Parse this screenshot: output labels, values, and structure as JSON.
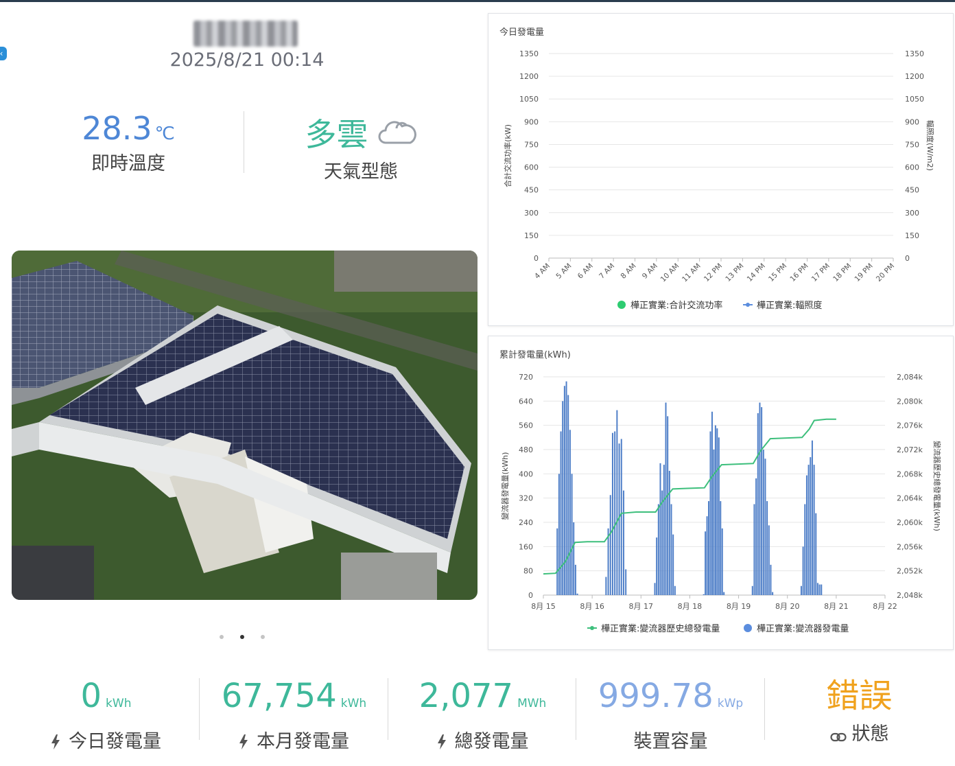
{
  "header": {
    "datetime": "2025/8/21 00:14"
  },
  "weather": {
    "temperature": "28.3",
    "temperature_unit": "℃",
    "temperature_label": "即時溫度",
    "type": "多雲",
    "type_label": "天氣型態",
    "icon": "cloud-icon"
  },
  "carousel": {
    "slide_count": 3,
    "active_index": 1
  },
  "today_chart": {
    "title": "今日發電量",
    "chart_data": {
      "type": "line",
      "ylabel": "合計交流功率(kW)",
      "ylabel_right": "輻照度(W/m2)",
      "y_ticks": [
        "0",
        "150",
        "300",
        "450",
        "600",
        "750",
        "900",
        "1050",
        "1200",
        "1350"
      ],
      "y_ticks_right": [
        "0",
        "150",
        "300",
        "450",
        "600",
        "750",
        "900",
        "1050",
        "1200",
        "1350"
      ],
      "x_ticks": [
        "4 AM",
        "5 AM",
        "6 AM",
        "7 AM",
        "8 AM",
        "9 AM",
        "10 AM",
        "11 AM",
        "12 PM",
        "13 PM",
        "14 PM",
        "15 PM",
        "16 PM",
        "17 PM",
        "18 PM",
        "19 PM",
        "20 PM"
      ],
      "ylim": [
        0,
        1350
      ],
      "series": [
        {
          "name": "樺正實業:合計交流功率",
          "color": "#2ecc71",
          "values": []
        },
        {
          "name": "樺正實業:輻照度",
          "color": "#5b8dde",
          "values": []
        }
      ],
      "legend": "bottom"
    }
  },
  "cumulative_chart": {
    "title": "累計發電量(kWh)",
    "chart_data": {
      "type": "bar",
      "ylabel": "變流器發電量(kWh)",
      "ylabel_right": "變流器歷史總發電量(kWh)",
      "y_ticks": [
        "0",
        "80",
        "160",
        "240",
        "320",
        "400",
        "480",
        "560",
        "640",
        "720"
      ],
      "y_ticks_right": [
        "2,048k",
        "2,052k",
        "2,056k",
        "2,060k",
        "2,064k",
        "2,068k",
        "2,072k",
        "2,076k",
        "2,080k",
        "2,084k"
      ],
      "x_ticks": [
        "8月 15",
        "8月 16",
        "8月 17",
        "8月 18",
        "8月 19",
        "8月 20",
        "8月 21",
        "8月 22"
      ],
      "ylim": [
        0,
        720
      ],
      "ylim_right": [
        2048000,
        2084000
      ],
      "bar_series": {
        "name": "樺正實業:變流器發電量",
        "color": "#4f7fc8",
        "days": [
          [
            220,
            400,
            540,
            640,
            690,
            705,
            660,
            545,
            400,
            240,
            100,
            5
          ],
          [
            60,
            220,
            330,
            535,
            540,
            610,
            500,
            515,
            345,
            85
          ],
          [
            40,
            190,
            300,
            435,
            345,
            430,
            635,
            590,
            410,
            300,
            200,
            30
          ],
          [
            3,
            210,
            260,
            310,
            540,
            605,
            480,
            560,
            550,
            520,
            310,
            220,
            10
          ],
          [
            30,
            300,
            385,
            600,
            635,
            620,
            480,
            450,
            310,
            230,
            100,
            10
          ],
          [
            30,
            160,
            300,
            395,
            430,
            455,
            510,
            430,
            270,
            40,
            35,
            35
          ]
        ]
      },
      "line_series": {
        "name": "樺正實業:變流器歷史總發電量",
        "color": "#3dbf7c",
        "points": [
          [
            15.0,
            2051.5
          ],
          [
            15.25,
            2051.6
          ],
          [
            15.45,
            2053.5
          ],
          [
            15.65,
            2056.7
          ],
          [
            15.9,
            2056.8
          ],
          [
            16.25,
            2056.8
          ],
          [
            16.4,
            2058.5
          ],
          [
            16.6,
            2061.5
          ],
          [
            16.9,
            2061.7
          ],
          [
            17.3,
            2061.7
          ],
          [
            17.45,
            2063.5
          ],
          [
            17.65,
            2065.5
          ],
          [
            17.95,
            2065.6
          ],
          [
            18.3,
            2065.7
          ],
          [
            18.45,
            2067.5
          ],
          [
            18.65,
            2069.5
          ],
          [
            18.95,
            2069.6
          ],
          [
            19.3,
            2069.7
          ],
          [
            19.45,
            2071.8
          ],
          [
            19.65,
            2073.8
          ],
          [
            19.95,
            2073.9
          ],
          [
            20.3,
            2074.0
          ],
          [
            20.45,
            2075.4
          ],
          [
            20.55,
            2076.8
          ],
          [
            20.8,
            2077.0
          ],
          [
            21.0,
            2077.0
          ]
        ]
      },
      "legend": "bottom"
    }
  },
  "stats": [
    {
      "value": "0",
      "unit": "kWh",
      "label": "今日發電量",
      "color": "#3eb89a",
      "icon": "bolt-icon"
    },
    {
      "value": "67,754",
      "unit": "kWh",
      "label": "本月發電量",
      "color": "#3eb89a",
      "icon": "bolt-icon"
    },
    {
      "value": "2,077",
      "unit": "MWh",
      "label": "總發電量",
      "color": "#3eb89a",
      "icon": "bolt-icon"
    },
    {
      "value": "999.78",
      "unit": "kWp",
      "label": "裝置容量",
      "color": "#85a9e3",
      "icon": ""
    },
    {
      "value": "錯誤",
      "unit": "",
      "label": "狀態",
      "color": "#f0a21e",
      "icon": "link-icon"
    }
  ]
}
